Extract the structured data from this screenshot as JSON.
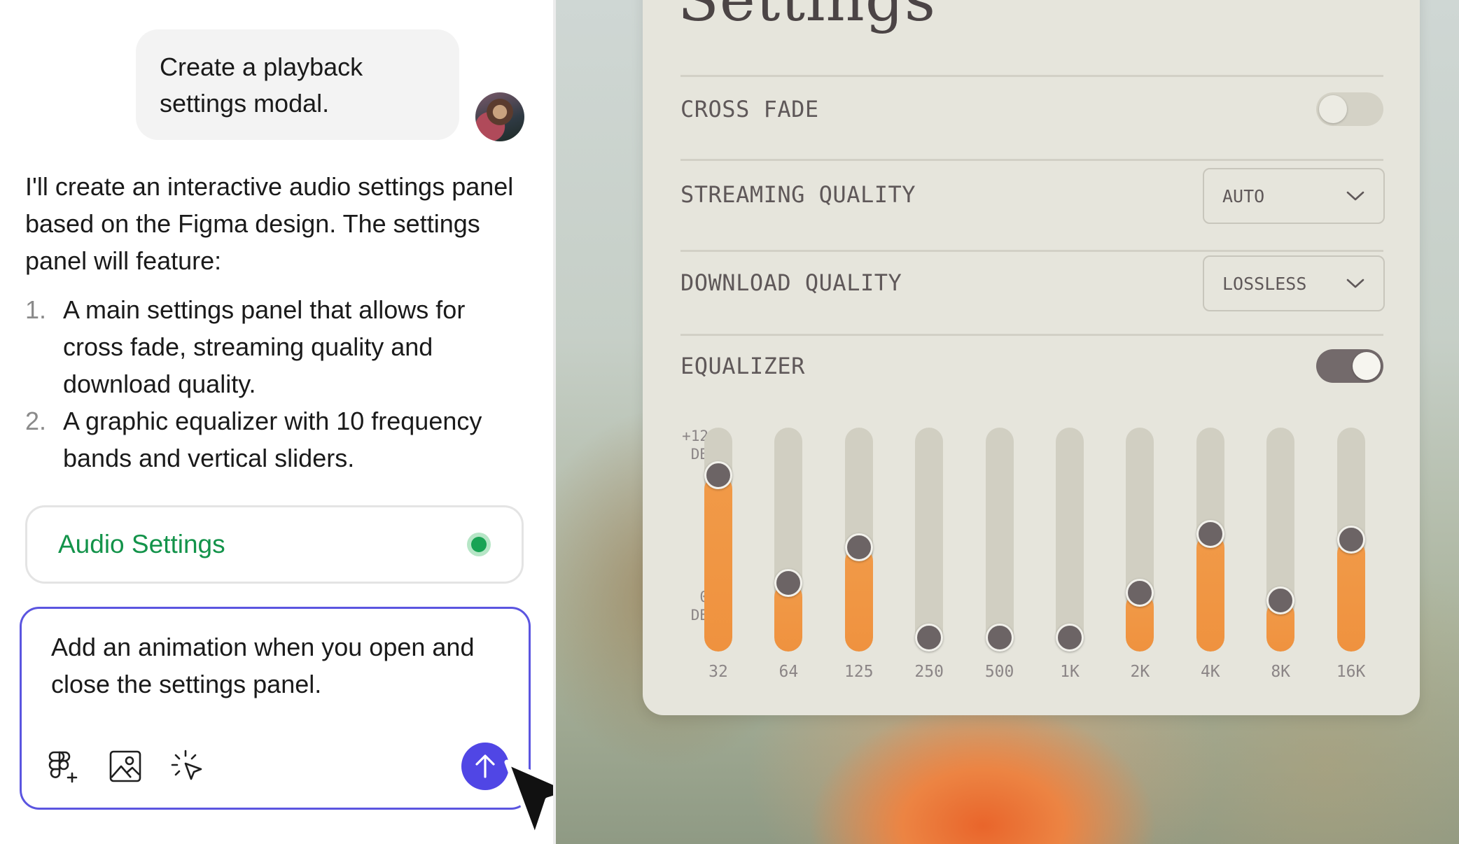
{
  "chat": {
    "user_message": "Create a playback settings modal.",
    "assistant_intro": "I'll create an interactive audio settings panel based on the Figma design. The settings panel will feature:",
    "assistant_list": [
      {
        "num": "1.",
        "text": "A main settings panel that allows for cross fade, streaming quality and download quality."
      },
      {
        "num": "2.",
        "text": "A graphic equalizer with 10 frequency bands and vertical sliders."
      }
    ],
    "artifact": {
      "title": "Audio Settings",
      "status_color": "#19a354"
    },
    "composer": {
      "text": "Add an animation when you open and close the settings panel.",
      "icons": [
        "figma-add-icon",
        "image-icon",
        "select-cursor-icon"
      ],
      "send_icon": "arrow-up-icon",
      "accent": "#5046e5"
    }
  },
  "settings": {
    "title": "Settings",
    "cross_fade": {
      "label": "CROSS FADE",
      "on": false
    },
    "streaming_quality": {
      "label": "STREAMING QUALITY",
      "value": "AUTO"
    },
    "download_quality": {
      "label": "DOWNLOAD QUALITY",
      "value": "LOSSLESS"
    },
    "equalizer": {
      "label": "EQUALIZER",
      "on": true,
      "top_label": "+12",
      "top_unit": "DB",
      "bottom_label": "0",
      "bottom_unit": "DB",
      "accent": "#f19a48",
      "bands": [
        {
          "freq": "32",
          "level": 0.83
        },
        {
          "freq": "64",
          "level": 0.28
        },
        {
          "freq": "125",
          "level": 0.46
        },
        {
          "freq": "250",
          "level": 0.0
        },
        {
          "freq": "500",
          "level": 0.0
        },
        {
          "freq": "1K",
          "level": 0.0
        },
        {
          "freq": "2K",
          "level": 0.23
        },
        {
          "freq": "4K",
          "level": 0.53
        },
        {
          "freq": "8K",
          "level": 0.19
        },
        {
          "freq": "16K",
          "level": 0.5
        }
      ]
    }
  }
}
